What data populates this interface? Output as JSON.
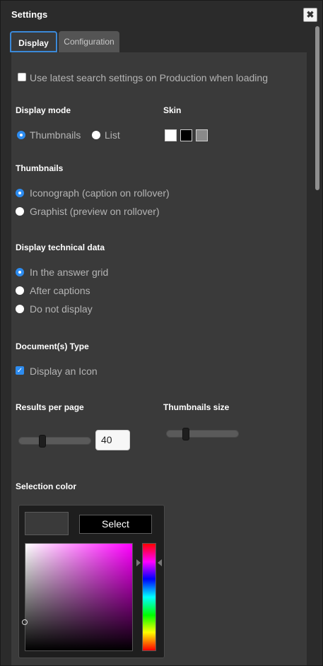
{
  "window": {
    "title": "Settings",
    "close_icon": "close-icon"
  },
  "tabs": [
    {
      "label": "Display",
      "active": true
    },
    {
      "label": "Configuration",
      "active": false
    }
  ],
  "use_latest": {
    "label": "Use latest search settings on Production when loading",
    "checked": false
  },
  "display_mode": {
    "heading": "Display mode",
    "options": [
      {
        "label": "Thumbnails",
        "selected": true
      },
      {
        "label": "List",
        "selected": false
      }
    ]
  },
  "skin": {
    "heading": "Skin",
    "swatches": [
      "#ffffff",
      "#000000",
      "#8a8a8a"
    ]
  },
  "thumbnails": {
    "heading": "Thumbnails",
    "options": [
      {
        "label": "Iconograph (caption on rollover)",
        "selected": true
      },
      {
        "label": "Graphist (preview on rollover)",
        "selected": false
      }
    ]
  },
  "technical_data": {
    "heading": "Display technical data",
    "options": [
      {
        "label": "In the answer grid",
        "selected": true
      },
      {
        "label": "After captions",
        "selected": false
      },
      {
        "label": "Do not display",
        "selected": false
      }
    ]
  },
  "document_type": {
    "heading": "Document(s) Type",
    "checkbox_label": "Display an Icon",
    "checked": true
  },
  "results_per_page": {
    "heading": "Results per page",
    "value": "40",
    "slider_fraction": 0.3
  },
  "thumbnails_size": {
    "heading": "Thumbnails size",
    "slider_fraction": 0.25
  },
  "selection_color": {
    "heading": "Selection color",
    "select_label": "Select",
    "current_color": "#3a3a3a",
    "hue_color": "#ff00ff"
  },
  "accent_color": "#2d8cf0"
}
